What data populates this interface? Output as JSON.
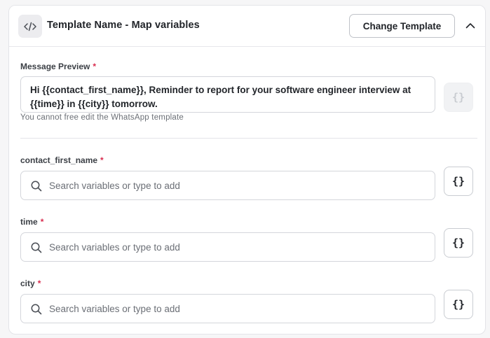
{
  "header": {
    "title": "Template Name - Map variables",
    "change_button": "Change Template",
    "code_icon": "code-icon",
    "collapse_icon": "chevron-up-icon"
  },
  "preview": {
    "label": "Message Preview",
    "required_mark": "*",
    "text": "Hi {{contact_first_name}}, Reminder to report for your software engineer interview at {{time}} in {{city}} tomorrow.",
    "helper": "You cannot free edit the WhatsApp template",
    "brace_label": "{}"
  },
  "variables": [
    {
      "label": "contact_first_name",
      "required_mark": "*",
      "placeholder": "Search variables or type to add",
      "value": "",
      "brace_label": "{}"
    },
    {
      "label": "time",
      "required_mark": "*",
      "placeholder": "Search variables or type to add",
      "value": "",
      "brace_label": "{}"
    },
    {
      "label": "city",
      "required_mark": "*",
      "placeholder": "Search variables or type to add",
      "value": "",
      "brace_label": "{}"
    }
  ],
  "colors": {
    "required": "#d92d4f",
    "border": "#d4d6db",
    "text": "#22252a"
  }
}
